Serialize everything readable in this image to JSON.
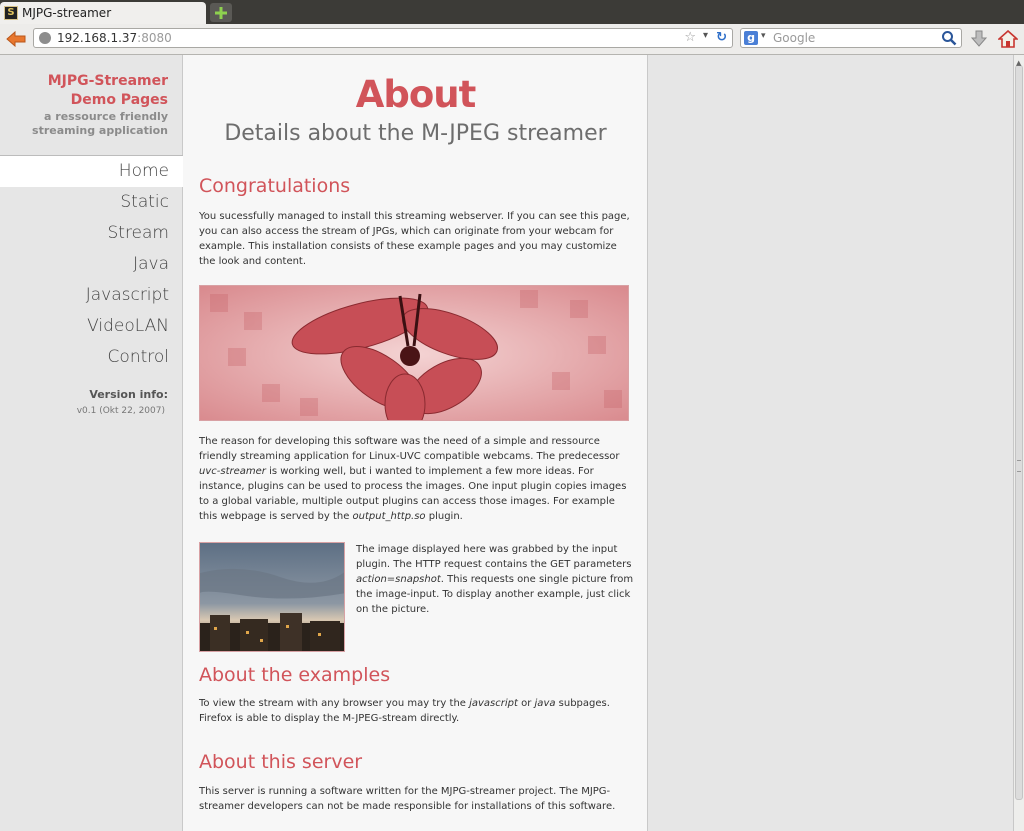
{
  "browser": {
    "tab_title": "MJPG-streamer",
    "url_host": "192.168.1.37",
    "url_port": ":8080",
    "search_placeholder": "Google"
  },
  "sidebar": {
    "logo_line1": "MJPG-Streamer",
    "logo_line2": "Demo Pages",
    "logo_sub1": "a ressource friendly",
    "logo_sub2": "streaming application",
    "nav": [
      "Home",
      "Static",
      "Stream",
      "Java",
      "Javascript",
      "VideoLAN",
      "Control"
    ],
    "active_index": 0,
    "version_label": "Version info:",
    "version_value": "v0.1 (Okt 22, 2007)"
  },
  "main": {
    "title": "About",
    "subtitle": "Details about the M-JPEG streamer",
    "section1_title": "Congratulations",
    "section1_text": "You sucessfully managed to install this streaming webserver. If you can see this page, you can also access the stream of JPGs, which can originate from your webcam for example. This installation consists of these example pages and you may customize the look and content.",
    "para2_a": "The reason for developing this software was the need of a simple and ressource friendly streaming application for Linux-UVC compatible webcams. The predecessor ",
    "para2_b": "uvc-streamer",
    "para2_c": " is working well, but i wanted to implement a few more ideas. For instance, plugins can be used to process the images. One input plugin copies images to a global variable, multiple output plugins can access those images. For example this webpage is served by the ",
    "para2_d": "output_http.so",
    "para2_e": " plugin.",
    "photo_text_a": "The image displayed here was grabbed by the input plugin. The HTTP request contains the GET parameters ",
    "photo_text_b": "action=snapshot",
    "photo_text_c": ". This requests one single picture from the image-input. To display another example, just click on the picture.",
    "section2_title": "About the examples",
    "section2_a": "To view the stream with any browser you may try the ",
    "section2_b": "javascript",
    "section2_c": " or ",
    "section2_d": "java",
    "section2_e": " subpages. Firefox is able to display the M-JPEG-stream directly.",
    "section3_title": "About this server",
    "section3_text": "This server is running a software written for the MJPG-streamer project. The MJPG-streamer developers can not be made responsible for installations of this software."
  },
  "colors": {
    "accent": "#d1545a",
    "sidebar_bg": "#e6e6e6",
    "content_bg": "#f7f7f7"
  }
}
